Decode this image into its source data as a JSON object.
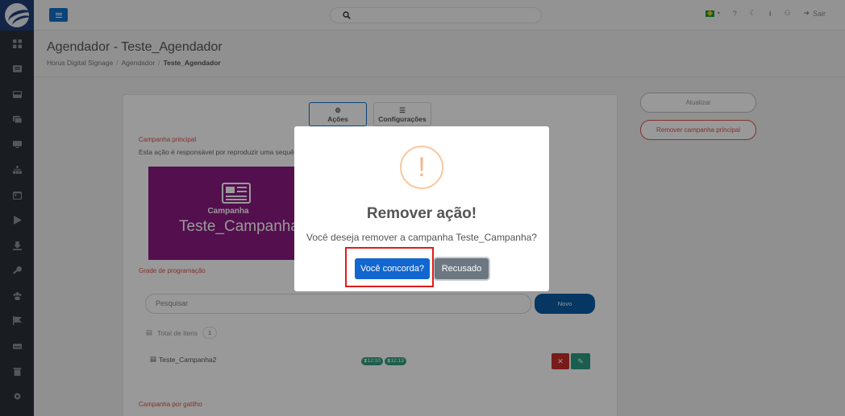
{
  "header": {
    "page_title": "Agendador - Teste_Agendador",
    "breadcrumb": [
      "Horus Digital Signage",
      "Agendador",
      "Teste_Agendador"
    ],
    "logout_label": "Sair"
  },
  "sidebar": {
    "icons": [
      "dashboard-icon",
      "list-icon",
      "inbox-icon",
      "gallery-icon",
      "monitor-icon",
      "sitemap-icon",
      "calendar-icon",
      "play-icon",
      "download-icon",
      "key-icon",
      "users-icon",
      "flag-icon",
      "drive-icon",
      "trash-icon",
      "gear-icon"
    ]
  },
  "tabs": [
    {
      "label": "Ações",
      "active": true
    },
    {
      "label": "Configurações",
      "active": false
    }
  ],
  "main": {
    "section_main_label": "Campanha principal",
    "description": "Esta ação é responsável por reproduzir uma sequên",
    "campaign_tile": {
      "subtitle": "Campanha",
      "name": "Teste_Campanha",
      "color": "#8a1a82"
    },
    "section_schedule_label": "Grade de programação",
    "search_placeholder": "Pesquisar",
    "new_label": "Novo",
    "total_label": "Total de itens",
    "total_count": "1",
    "rows": [
      {
        "name": "Teste_Campanha2",
        "start": "12:10",
        "end": "12:13"
      }
    ],
    "section_trigger_label": "Campanha por gatilho"
  },
  "right_panel": {
    "update_label": "Atualizar",
    "remove_label": "Remover campanha principal"
  },
  "modal": {
    "title": "Remover ação!",
    "text": "Você deseja remover a campanha Teste_Campanha?",
    "confirm_label": "Você concorda?",
    "cancel_label": "Recusado",
    "icon": "!"
  },
  "colors": {
    "accent": "#1771c8",
    "danger": "#d9534f",
    "confirm": "#1266d0",
    "highlight": "#e21b1b"
  }
}
